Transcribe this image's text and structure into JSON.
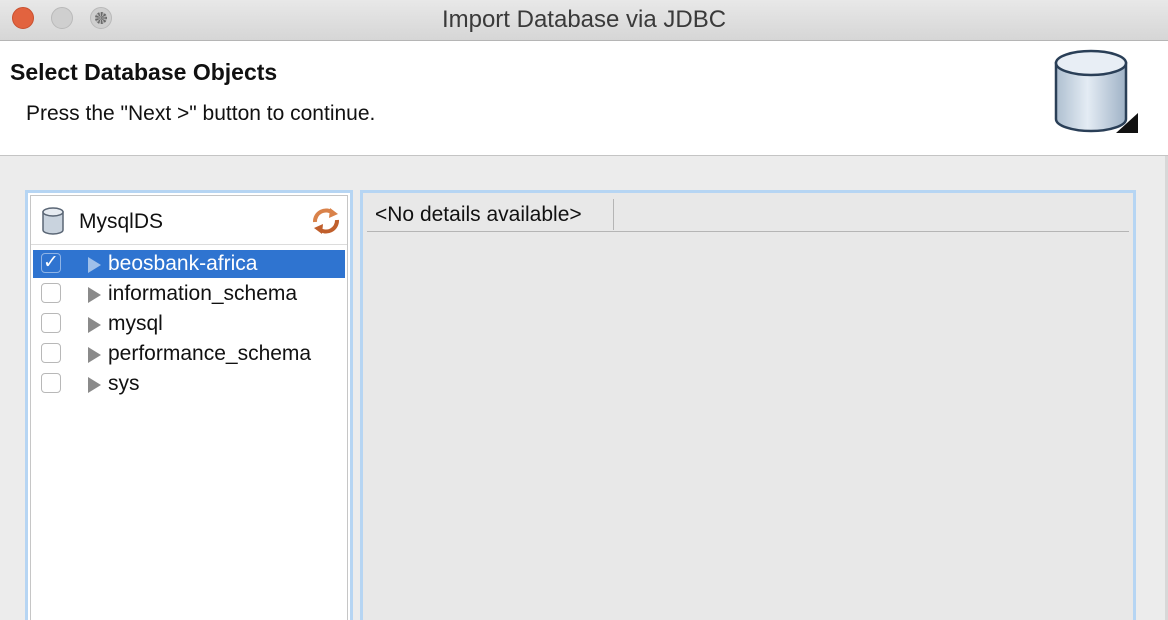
{
  "window": {
    "title": "Import Database via JDBC"
  },
  "header": {
    "title": "Select Database Objects",
    "subtitle": "Press the \"Next >\" button to continue.",
    "icon": "database-icon"
  },
  "tree": {
    "root_label": "MysqlDS",
    "root_icon": "database-icon",
    "refresh_icon": "refresh-icon",
    "items": [
      {
        "label": "beosbank-africa",
        "checked": true,
        "selected": true
      },
      {
        "label": "information_schema",
        "checked": false,
        "selected": false
      },
      {
        "label": "mysql",
        "checked": false,
        "selected": false
      },
      {
        "label": "performance_schema",
        "checked": false,
        "selected": false
      },
      {
        "label": "sys",
        "checked": false,
        "selected": false
      }
    ]
  },
  "details": {
    "tab_label": "<No details available>"
  },
  "colors": {
    "selection": "#2f74d0",
    "panel_border": "#b6d5f3",
    "close_button": "#e2633f"
  }
}
